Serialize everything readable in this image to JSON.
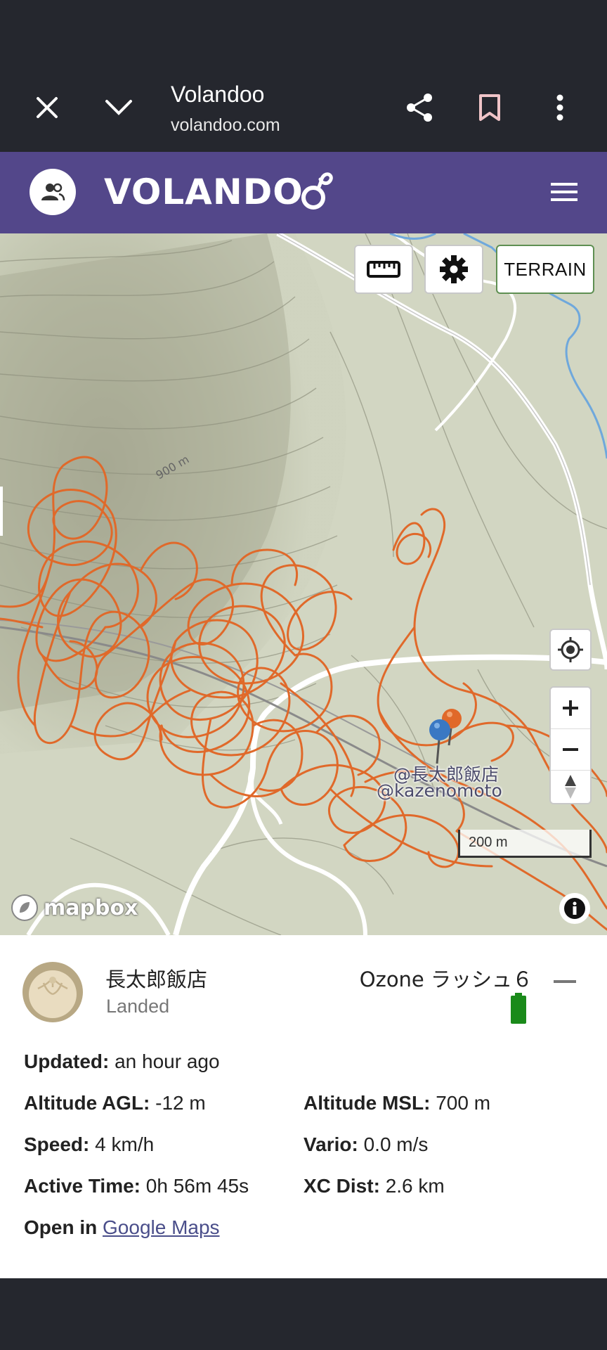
{
  "browser": {
    "title": "Volandoo",
    "url": "volandoo.com"
  },
  "header": {
    "logo_text": "VOLANDO",
    "brand_color": "#53478a"
  },
  "map": {
    "controls": {
      "terrain_label": "TERRAIN"
    },
    "contour_label": "900 m",
    "pin_labels": [
      "@長太郎飯店",
      "@kazenomoto"
    ],
    "scale_label": "200 m",
    "attribution": "mapbox",
    "track_color": "#e0692a"
  },
  "panel": {
    "pilot_name": "長太郎飯店",
    "status": "Landed",
    "glider": "Ozone ラッシュ６",
    "updated_label": "Updated:",
    "updated_value": "an hour ago",
    "agl_label": "Altitude AGL:",
    "agl_value": "-12 m",
    "msl_label": "Altitude MSL:",
    "msl_value": "700 m",
    "speed_label": "Speed:",
    "speed_value": "4 km/h",
    "vario_label": "Vario:",
    "vario_value": "0.0 m/s",
    "active_label": "Active Time:",
    "active_value": "0h 56m 45s",
    "xc_label": "XC Dist:",
    "xc_value": "2.6 km",
    "open_in_label": "Open in",
    "maps_link": "Google Maps"
  }
}
